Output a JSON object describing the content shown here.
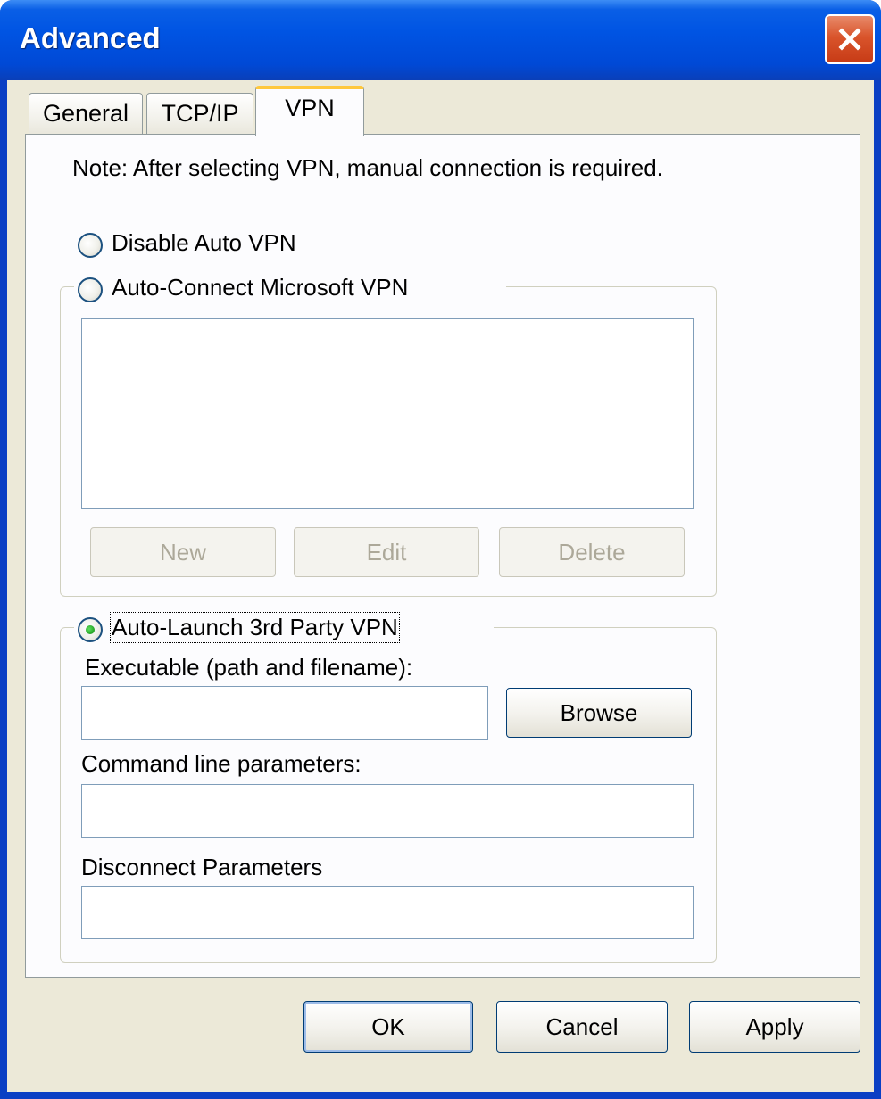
{
  "window": {
    "title": "Advanced"
  },
  "tabs": [
    {
      "label": "General",
      "active": false
    },
    {
      "label": "TCP/IP",
      "active": false
    },
    {
      "label": "VPN",
      "active": true
    }
  ],
  "vpn": {
    "note": "Note: After selecting VPN, manual connection is required.",
    "options": {
      "disable_auto": "Disable Auto VPN",
      "auto_connect_ms": "Auto-Connect Microsoft VPN",
      "auto_launch_3rd": "Auto-Launch 3rd Party VPN",
      "selected": "auto_launch_3rd"
    },
    "ms_vpn": {
      "list_items": [],
      "buttons": {
        "new": "New",
        "edit": "Edit",
        "delete": "Delete"
      }
    },
    "third_party": {
      "executable_label": "Executable (path and filename):",
      "executable_value": "",
      "browse_label": "Browse",
      "command_label": "Command line parameters:",
      "command_value": "",
      "disconnect_label": "Disconnect Parameters",
      "disconnect_value": ""
    }
  },
  "footer": {
    "ok": "OK",
    "cancel": "Cancel",
    "apply": "Apply"
  },
  "colors": {
    "title_bar": "#0054e3",
    "client_bg": "#ece9d8",
    "close_button": "#d9542b",
    "active_tab_accent": "#ffc83c"
  }
}
